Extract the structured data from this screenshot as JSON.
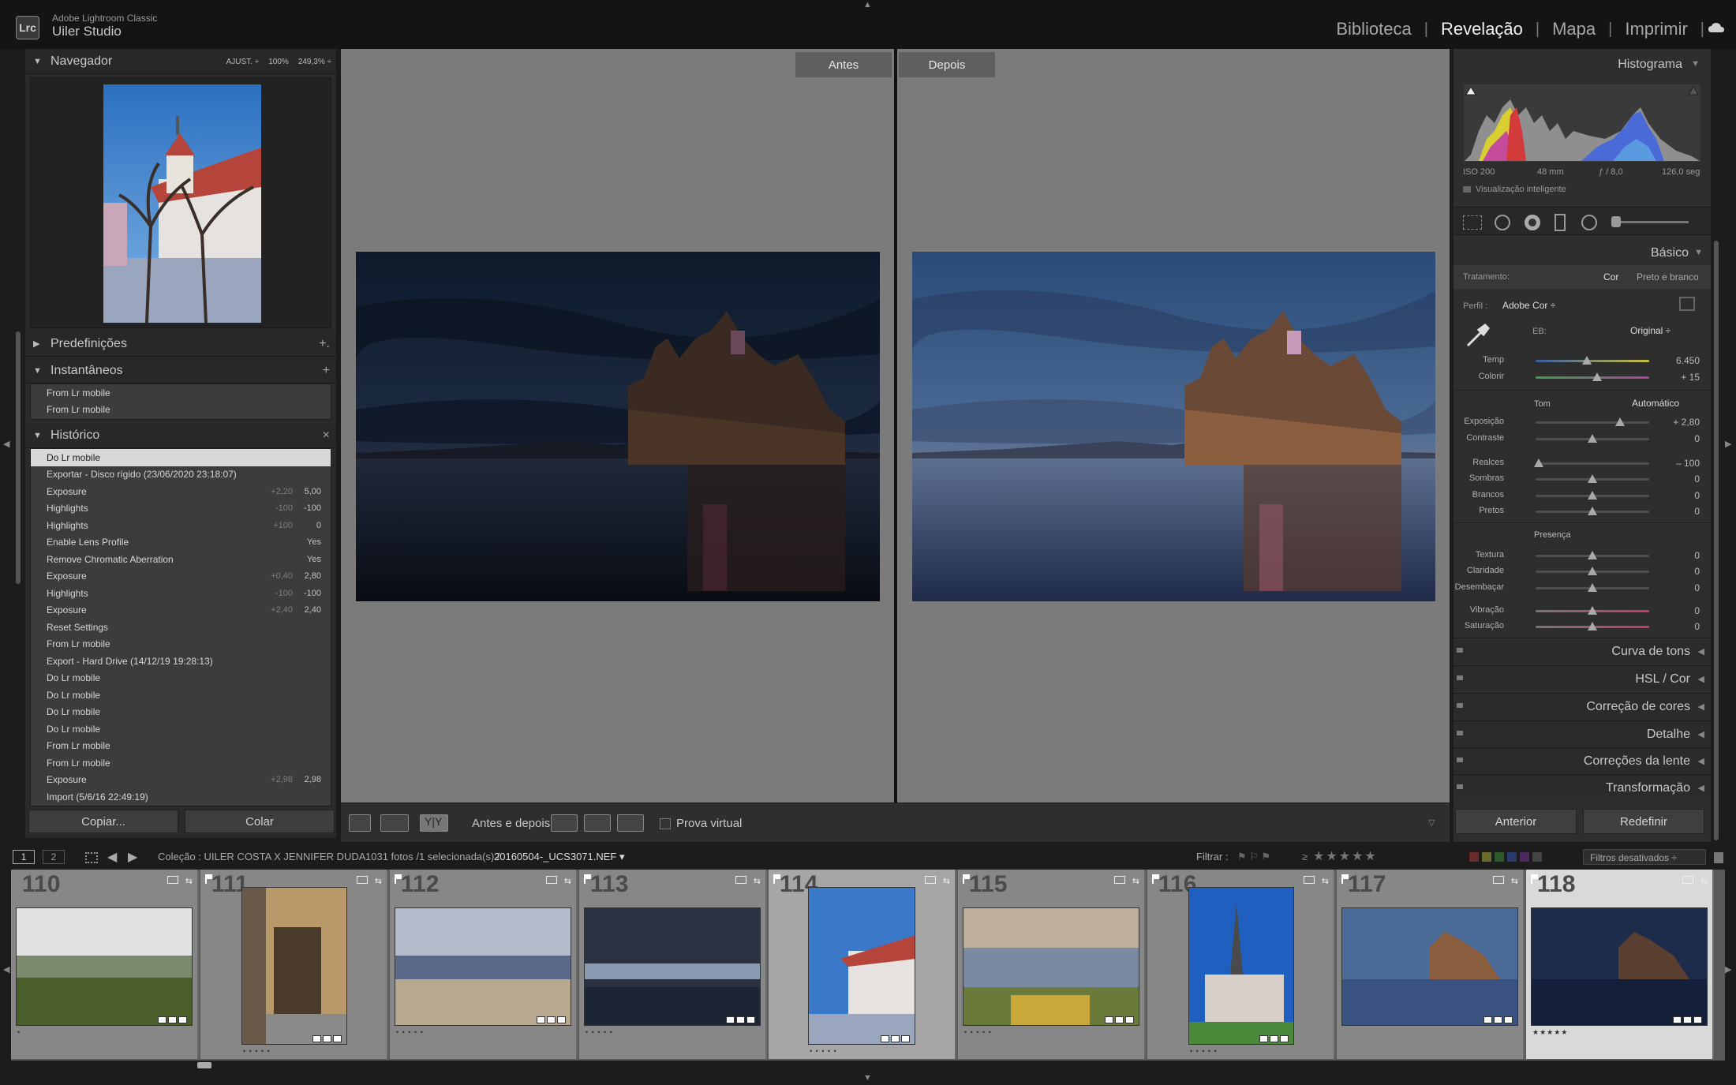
{
  "app": {
    "logo": "Lrc",
    "name": "Adobe Lightroom Classic",
    "studio": "Uiler Studio"
  },
  "modules": [
    "Biblioteca",
    "Revelação",
    "Mapa",
    "Imprimir"
  ],
  "active_module": "Revelação",
  "left": {
    "navigator": {
      "title": "Navegador",
      "opts": [
        "AJUST. ÷",
        "100%",
        "249,3% ÷"
      ]
    },
    "presets": {
      "title": "Predefinições",
      "action": "+."
    },
    "snapshots": {
      "title": "Instantâneos",
      "action": "+",
      "items": [
        "From Lr mobile",
        "From Lr mobile"
      ]
    },
    "history": {
      "title": "Histórico",
      "action": "×",
      "items": [
        {
          "label": "Do Lr mobile",
          "c1": "",
          "c2": ""
        },
        {
          "label": "Exportar - Disco rígido (23/06/2020 23:18:07)",
          "c1": "",
          "c2": ""
        },
        {
          "label": "Exposure",
          "c1": "+2,20",
          "c2": "5,00"
        },
        {
          "label": "Highlights",
          "c1": "-100",
          "c2": "-100"
        },
        {
          "label": "Highlights",
          "c1": "+100",
          "c2": "0"
        },
        {
          "label": "Enable Lens Profile",
          "c1": "",
          "c2": "Yes"
        },
        {
          "label": "Remove Chromatic Aberration",
          "c1": "",
          "c2": "Yes"
        },
        {
          "label": "Exposure",
          "c1": "+0,40",
          "c2": "2,80"
        },
        {
          "label": "Highlights",
          "c1": "-100",
          "c2": "-100"
        },
        {
          "label": "Exposure",
          "c1": "+2,40",
          "c2": "2,40"
        },
        {
          "label": "Reset Settings",
          "c1": "",
          "c2": ""
        },
        {
          "label": "From Lr mobile",
          "c1": "",
          "c2": ""
        },
        {
          "label": "Export - Hard Drive (14/12/19 19:28:13)",
          "c1": "",
          "c2": ""
        },
        {
          "label": "Do Lr mobile",
          "c1": "",
          "c2": ""
        },
        {
          "label": "Do Lr mobile",
          "c1": "",
          "c2": ""
        },
        {
          "label": "Do Lr mobile",
          "c1": "",
          "c2": ""
        },
        {
          "label": "Do Lr mobile",
          "c1": "",
          "c2": ""
        },
        {
          "label": "From Lr mobile",
          "c1": "",
          "c2": ""
        },
        {
          "label": "From Lr mobile",
          "c1": "",
          "c2": ""
        },
        {
          "label": "Exposure",
          "c1": "+2,98",
          "c2": "2,98"
        },
        {
          "label": "Import (5/6/16 22:49:19)",
          "c1": "",
          "c2": ""
        }
      ]
    },
    "copy_label": "Copiar...",
    "paste_label": "Colar"
  },
  "center": {
    "before_label": "Antes",
    "after_label": "Depois",
    "toolbar": {
      "before_after_label": "Antes e depois:",
      "soft_proof_label": "Prova virtual",
      "yy_label": "Y|Y"
    }
  },
  "right": {
    "histogram": {
      "title": "Histograma",
      "iso": "ISO 200",
      "focal": "48 mm",
      "aperture": "ƒ / 8,0",
      "shutter": "126,0 seg",
      "smart_preview": "Visualização inteligente"
    },
    "basic": {
      "title": "Básico",
      "treatment_label": "Tratamento:",
      "treatment_color": "Cor",
      "treatment_bw": "Preto e branco",
      "profile_label": "Perfil :",
      "profile_value": "Adobe Cor ÷",
      "wb_label": "EB:",
      "wb_value": "Original ÷",
      "tone_label": "Tom",
      "auto_label": "Automático",
      "presence_label": "Presença"
    },
    "sliders": [
      {
        "label": "Temp",
        "value": "6.450",
        "pos": 0.45,
        "grad": "temp"
      },
      {
        "label": "Colorir",
        "value": "+ 15",
        "pos": 0.54,
        "grad": "tint"
      },
      {
        "label": "Exposição",
        "value": "+ 2,80",
        "pos": 0.74,
        "grad": ""
      },
      {
        "label": "Contraste",
        "value": "0",
        "pos": 0.5,
        "grad": ""
      },
      {
        "label": "Realces",
        "value": "– 100",
        "pos": 0.03,
        "grad": ""
      },
      {
        "label": "Sombras",
        "value": "0",
        "pos": 0.5,
        "grad": ""
      },
      {
        "label": "Brancos",
        "value": "0",
        "pos": 0.5,
        "grad": ""
      },
      {
        "label": "Pretos",
        "value": "0",
        "pos": 0.5,
        "grad": ""
      },
      {
        "label": "Textura",
        "value": "0",
        "pos": 0.5,
        "grad": ""
      },
      {
        "label": "Claridade",
        "value": "0",
        "pos": 0.5,
        "grad": ""
      },
      {
        "label": "Desembaçar",
        "value": "0",
        "pos": 0.5,
        "grad": ""
      },
      {
        "label": "Vibração",
        "value": "0",
        "pos": 0.5,
        "grad": "vib"
      },
      {
        "label": "Saturação",
        "value": "0",
        "pos": 0.5,
        "grad": "sat"
      }
    ],
    "sections": [
      "Curva de tons",
      "HSL / Cor",
      "Correção de cores",
      "Detalhe",
      "Correções da lente",
      "Transformação"
    ],
    "prev_label": "Anterior",
    "reset_label": "Redefinir"
  },
  "filmbar": {
    "page1": "1",
    "page2": "2",
    "collection": "Coleção : UILER COSTA X JENNIFER DUDA",
    "count": "1031 fotos /1 selecionada(s) /",
    "filename": "20160504-_UCS3071.NEF ▾",
    "filter_label": "Filtrar :",
    "filters_off": "Filtros desativados ÷"
  },
  "filmstrip": [
    {
      "num": "110",
      "stars": "•"
    },
    {
      "num": "111",
      "stars": "• • • • •"
    },
    {
      "num": "112",
      "stars": "• • • • •"
    },
    {
      "num": "113",
      "stars": "• • • • •"
    },
    {
      "num": "114",
      "stars": "• • • • •"
    },
    {
      "num": "115",
      "stars": "• • • • •"
    },
    {
      "num": "116",
      "stars": "• • • • •"
    },
    {
      "num": "117",
      "stars": ""
    },
    {
      "num": "118",
      "stars": "★★★★★"
    }
  ],
  "colors": {
    "accent_active": "#f0f0f0",
    "panel_bg": "#2a2a2a",
    "canvas_bg": "#7b7b7b"
  }
}
